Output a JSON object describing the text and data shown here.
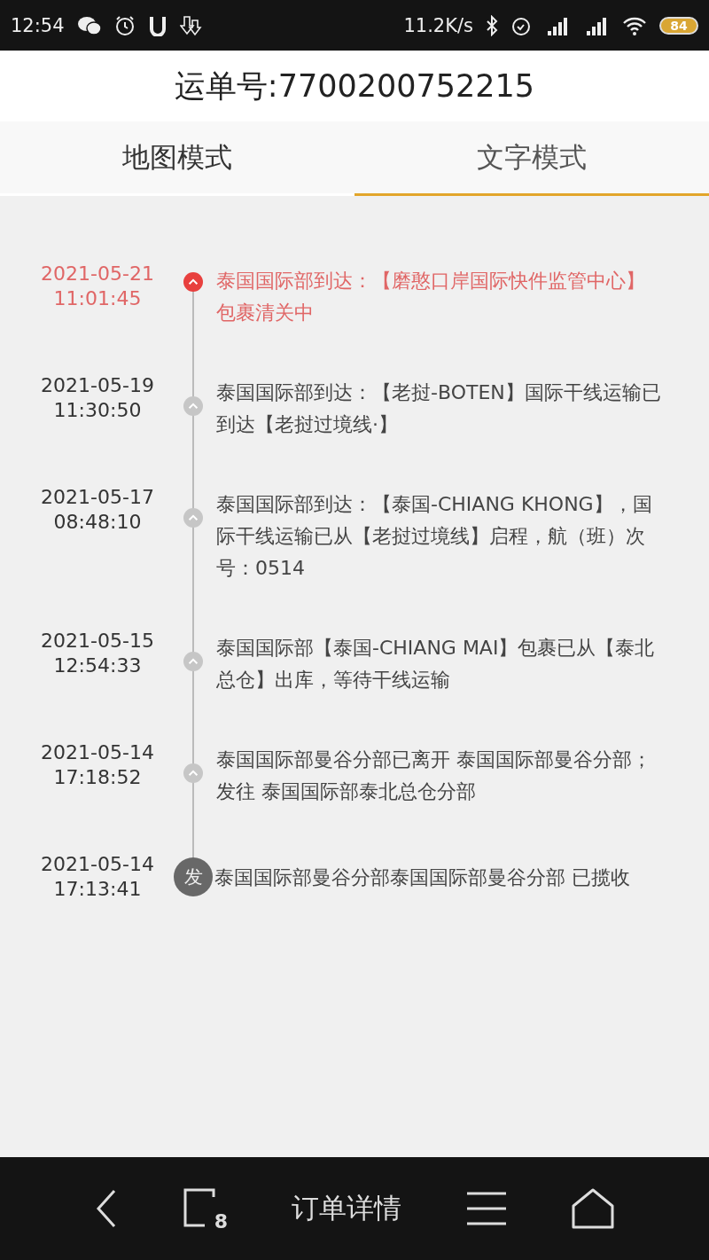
{
  "status_bar": {
    "time": "12:54",
    "network_speed": "11.2K/s",
    "battery": "84"
  },
  "header": {
    "title": "运单号:7700200752215"
  },
  "tabs": [
    {
      "label": "地图模式",
      "selected": false
    },
    {
      "label": "文字模式",
      "selected": true
    }
  ],
  "timeline": [
    {
      "kind": "latest",
      "date": "2021-05-21",
      "time": "11:01:45",
      "text": "泰国国际部到达：【磨憨口岸国际快件监管中心】包裹清关中"
    },
    {
      "kind": "normal",
      "date": "2021-05-19",
      "time": "11:30:50",
      "text": "泰国国际部到达：【老挝-BOTEN】国际干线运输已到达【老挝过境线·】"
    },
    {
      "kind": "normal",
      "date": "2021-05-17",
      "time": "08:48:10",
      "text": "泰国国际部到达：【泰国-CHIANG KHONG】，国际干线运输已从【老挝过境线】启程，航（班）次号：0514"
    },
    {
      "kind": "normal",
      "date": "2021-05-15",
      "time": "12:54:33",
      "text": "泰国国际部【泰国-CHIANG MAI】包裹已从【泰北总仓】出库，等待干线运输"
    },
    {
      "kind": "normal",
      "date": "2021-05-14",
      "time": "17:18:52",
      "text": "泰国国际部曼谷分部已离开 泰国国际部曼谷分部；发往 泰国国际部泰北总仓分部"
    },
    {
      "kind": "origin",
      "badge": "发",
      "date": "2021-05-14",
      "time": "17:13:41",
      "text": "泰国国际部曼谷分部泰国国际部曼谷分部 已揽收"
    }
  ],
  "bottom_nav": {
    "tab_count": "8",
    "title": "订单详情"
  }
}
